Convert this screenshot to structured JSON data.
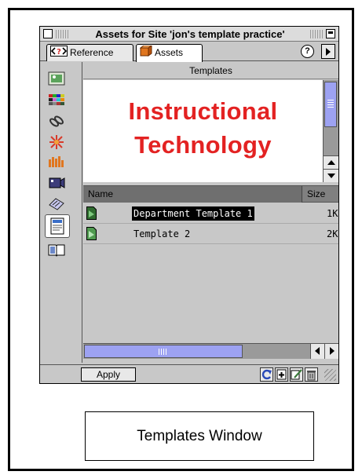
{
  "window": {
    "title": "Assets for Site 'jon's template practice'"
  },
  "tabs": [
    {
      "label": "Reference",
      "selected": false
    },
    {
      "label": "Assets",
      "selected": true
    }
  ],
  "categories": [
    {
      "icon": "images-icon"
    },
    {
      "icon": "colors-icon"
    },
    {
      "icon": "urls-icon"
    },
    {
      "icon": "flash-icon"
    },
    {
      "icon": "shockwave-icon"
    },
    {
      "icon": "movies-icon"
    },
    {
      "icon": "scripts-icon"
    },
    {
      "icon": "templates-icon",
      "selected": true
    },
    {
      "icon": "library-icon"
    }
  ],
  "panel": {
    "section_title": "Templates",
    "preview_line1": "Instructional",
    "preview_line2": "Technology",
    "preview_color": "#e32222"
  },
  "list": {
    "columns": [
      "Name",
      "Size"
    ],
    "rows": [
      {
        "name": "Department Template 1",
        "size": "1K",
        "selected": true
      },
      {
        "name": "Template 2",
        "size": "2K",
        "selected": false
      }
    ]
  },
  "bottom": {
    "apply_label": "Apply",
    "tools": [
      "refresh-icon",
      "new-template-icon",
      "edit-icon",
      "trash-icon"
    ]
  },
  "caption": "Templates Window",
  "colors": {
    "scroll_thumb": "#9da2f2",
    "chrome": "#c8c8c8"
  }
}
